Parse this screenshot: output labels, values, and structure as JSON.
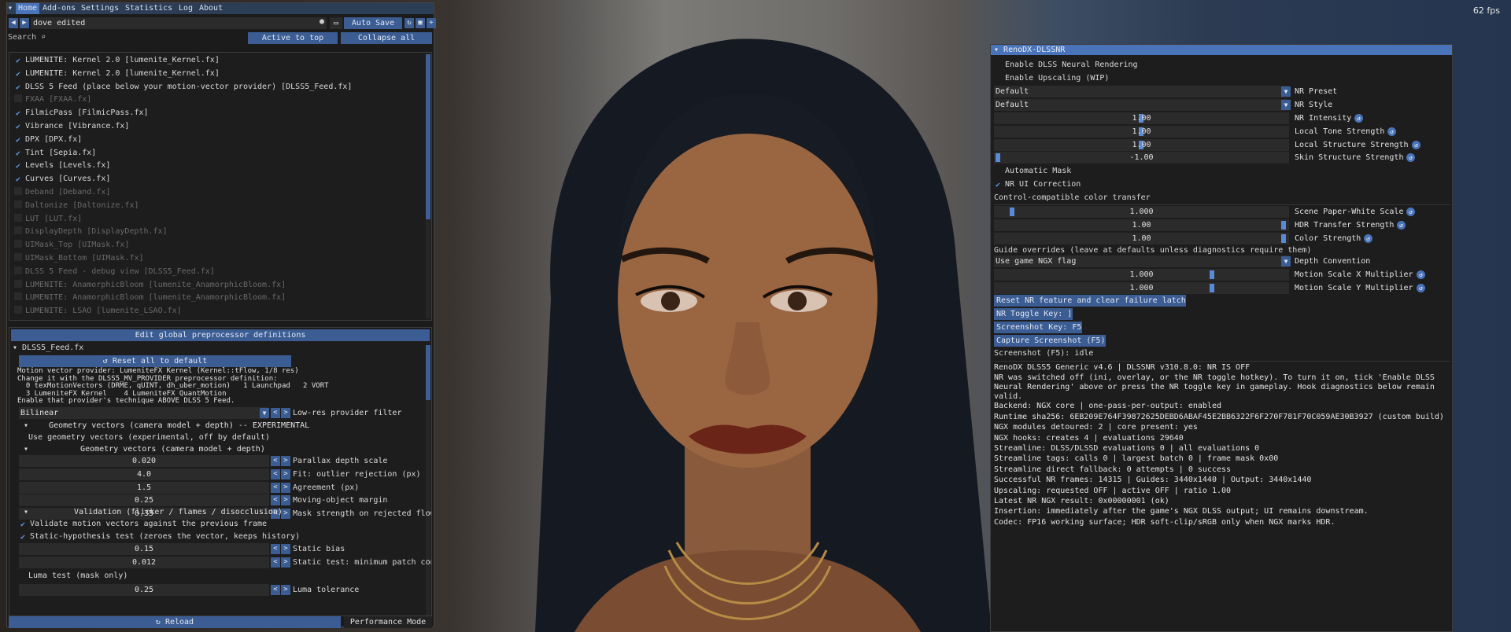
{
  "fps": "62 fps",
  "menu": {
    "items": [
      "Home",
      "Add-ons",
      "Settings",
      "Statistics",
      "Log",
      "About"
    ],
    "active_index": 0
  },
  "preset": {
    "name": "dove edited",
    "auto_save_label": "Auto Save"
  },
  "search": {
    "label": "Search",
    "active_to_top_label": "Active to top",
    "collapse_all_label": "Collapse all"
  },
  "effects": [
    {
      "label": "LUMENITE: Kernel 2.0 [lumenite_Kernel.fx]",
      "enabled": true
    },
    {
      "label": "LUMENITE: Kernel 2.0 [lumenite_Kernel.fx]",
      "enabled": true
    },
    {
      "label": "DLSS 5 Feed (place below your motion-vector provider) [DLSS5_Feed.fx]",
      "enabled": true
    },
    {
      "label": "FXAA [FXAA.fx]",
      "enabled": false
    },
    {
      "label": "FilmicPass [FilmicPass.fx]",
      "enabled": true
    },
    {
      "label": "Vibrance [Vibrance.fx]",
      "enabled": true
    },
    {
      "label": "DPX [DPX.fx]",
      "enabled": true
    },
    {
      "label": "Tint [Sepia.fx]",
      "enabled": true
    },
    {
      "label": "Levels [Levels.fx]",
      "enabled": true
    },
    {
      "label": "Curves [Curves.fx]",
      "enabled": true
    },
    {
      "label": "Deband [Deband.fx]",
      "enabled": false
    },
    {
      "label": "Daltonize [Daltonize.fx]",
      "enabled": false
    },
    {
      "label": "LUT [LUT.fx]",
      "enabled": false
    },
    {
      "label": "DisplayDepth [DisplayDepth.fx]",
      "enabled": false
    },
    {
      "label": "UIMask_Top [UIMask.fx]",
      "enabled": false
    },
    {
      "label": "UIMask_Bottom [UIMask.fx]",
      "enabled": false
    },
    {
      "label": "DLSS 5 Feed - debug view [DLSS5_Feed.fx]",
      "enabled": false
    },
    {
      "label": "LUMENITE: AnamorphicBloom [lumenite_AnamorphicBloom.fx]",
      "enabled": false
    },
    {
      "label": "LUMENITE: AnamorphicBloom [lumenite_AnamorphicBloom.fx]",
      "enabled": false
    },
    {
      "label": "LUMENITE: LSAO [lumenite_LSAO.fx]",
      "enabled": false
    }
  ],
  "preprocessor": {
    "header_label": "Edit global preprocessor definitions",
    "file_label": "DLSS5_Feed.fx",
    "reset_label": "Reset all to default",
    "notes": [
      "Motion vector provider: LumeniteFX Kernel (Kernel::tFlow, 1/8 res)",
      "Change it with the DLSS5_MV_PROVIDER preprocessor definition:",
      "  0 texMotionVectors (DRME, qUINT, dh_uber_motion)   1 Launchpad   2 VORT",
      "  3 LumeniteFX Kernel    4 LumeniteFX QuantMotion",
      "Enable that provider's technique ABOVE DLSS 5 Feed."
    ],
    "provider_filter": {
      "value": "Bilinear",
      "label": "Low-res provider filter"
    },
    "geom_exp_header": "Geometry vectors (camera model + depth) -- EXPERIMENTAL",
    "geom_use_label": "Use geometry vectors (experimental, off by default)",
    "geom_header": "Geometry vectors (camera model + depth)",
    "params": [
      {
        "value": "0.020",
        "label": "Parallax depth scale"
      },
      {
        "value": "4.0",
        "label": "Fit: outlier rejection (px)"
      },
      {
        "value": "1.5",
        "label": "Agreement (px)"
      },
      {
        "value": "0.25",
        "label": "Moving-object margin"
      },
      {
        "value": "0.35",
        "label": "Mask strength on rejected flow"
      }
    ],
    "validation_header": "Validation (flicker / flames / disocclusion)",
    "validate_label": "Validate motion vectors against the previous frame",
    "static_label": "Static-hypothesis test (zeroes the vector, keeps history)",
    "params2": [
      {
        "value": "0.15",
        "label": "Static bias"
      },
      {
        "value": "0.012",
        "label": "Static test: minimum patch contrast"
      }
    ],
    "luma_label": "Luma test (mask only)",
    "luma_tol": {
      "value": "0.25",
      "label": "Luma tolerance"
    }
  },
  "footer": {
    "reload_label": "Reload",
    "perf_label": "Performance Mode"
  },
  "renodx": {
    "title": "RenoDX-DLSSNR",
    "enable_nr_label": "Enable DLSS Neural Rendering",
    "enable_upscale_label": "Enable Upscaling (WIP)",
    "nr_preset": {
      "value": "Default",
      "label": "NR Preset"
    },
    "nr_style": {
      "value": "Default",
      "label": "NR Style"
    },
    "sliders1": [
      {
        "value": "1.00",
        "label": "NR Intensity",
        "fill": 0.5
      },
      {
        "value": "1.00",
        "label": "Local Tone Strength",
        "fill": 0.5
      },
      {
        "value": "1.00",
        "label": "Local Structure Strength",
        "fill": 0.5
      },
      {
        "value": "-1.00",
        "label": "Skin Structure Strength",
        "fill": 0.0
      }
    ],
    "auto_mask_label": "Automatic Mask",
    "ui_correction_label": "NR UI Correction",
    "color_transfer_header": "Control-compatible color transfer",
    "sliders2": [
      {
        "value": "1.000",
        "label": "Scene Paper-White Scale",
        "fill": 0.05
      },
      {
        "value": "1.00",
        "label": "HDR Transfer Strength",
        "fill": 1.0
      },
      {
        "value": "1.00",
        "label": "Color Strength",
        "fill": 1.0
      }
    ],
    "guide_header": "Guide overrides (leave at defaults unless diagnostics require them)",
    "depth_convention": {
      "value": "Use game NGX flag",
      "label": "Depth Convention"
    },
    "sliders3": [
      {
        "value": "1.000",
        "label": "Motion Scale X Multiplier",
        "fill": 0.75
      },
      {
        "value": "1.000",
        "label": "Motion Scale Y Multiplier",
        "fill": 0.75
      }
    ],
    "reset_feature_label": "Reset NR feature and clear failure latch",
    "nr_toggle_label": "NR Toggle Key: ]",
    "screenshot_key_label": "Screenshot Key: F5",
    "capture_label": "Capture Screenshot (F5)",
    "screenshot_status": "Screenshot (F5): idle",
    "info": [
      "RenoDX DLSS5 Generic v4.6 | DLSSNR v310.8.0: NR IS OFF",
      "NR was switched off (ini, overlay, or the NR toggle hotkey). To turn it on, tick 'Enable DLSS Neural Rendering' above or press the NR toggle key in gameplay. Hook diagnostics below remain valid.",
      "Backend: NGX core | one-pass-per-output: enabled",
      "Runtime sha256: 6EB209E764F39872625DEBD6ABAF45E2BB6322F6F270F781F70C059AE30B3927 (custom build)",
      "NGX modules detoured: 2 | core present: yes",
      "NGX hooks: creates 4 | evaluations 29640",
      "Streamline: DLSS/DLSSD evaluations 0 | all evaluations 0",
      "Streamline tags: calls 0 | largest batch 0 | frame mask 0x00",
      "Streamline direct fallback: 0 attempts | 0 success",
      "Successful NR frames: 14315 | Guides: 3440x1440 | Output: 3440x1440",
      "Upscaling: requested OFF | active OFF | ratio 1.00",
      "Latest NR NGX result: 0x00000001 (ok)",
      "Insertion: immediately after the game's NGX DLSS output; UI remains downstream.",
      "Codec: FP16 working surface; HDR soft-clip/sRGB only when NGX marks HDR."
    ]
  }
}
